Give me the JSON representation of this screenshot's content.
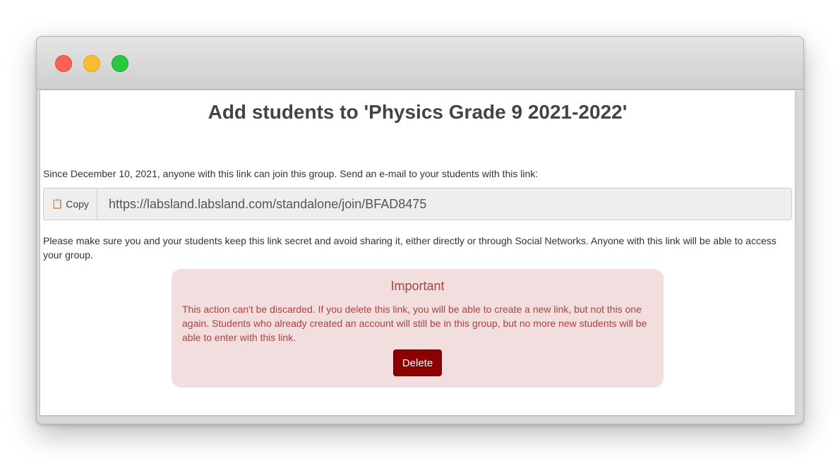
{
  "window": {
    "controls": [
      "close",
      "minimize",
      "maximize"
    ]
  },
  "page": {
    "title": "Add students to 'Physics Grade 9 2021-2022'",
    "since_text": "Since December 10, 2021, anyone with this link can join this group. Send an e-mail to your students with this link:",
    "copy_label": "Copy",
    "join_link": "https://labsland.labsland.com/standalone/join/BFAD8475",
    "secret_text": "Please make sure you and your students keep this link secret and avoid sharing it, either directly or through Social Networks. Anyone with this link will be able to access your group."
  },
  "alert": {
    "title": "Important",
    "body": "This action can't be discarded. If you delete this link, you will be able to create a new link, but not this one again. Students who already created an account will still be in this group, but no more new students will be able to enter with this link.",
    "delete_label": "Delete"
  },
  "colors": {
    "alert_bg": "#f2dede",
    "alert_text": "#a94442",
    "delete_bg": "#8b0000"
  }
}
